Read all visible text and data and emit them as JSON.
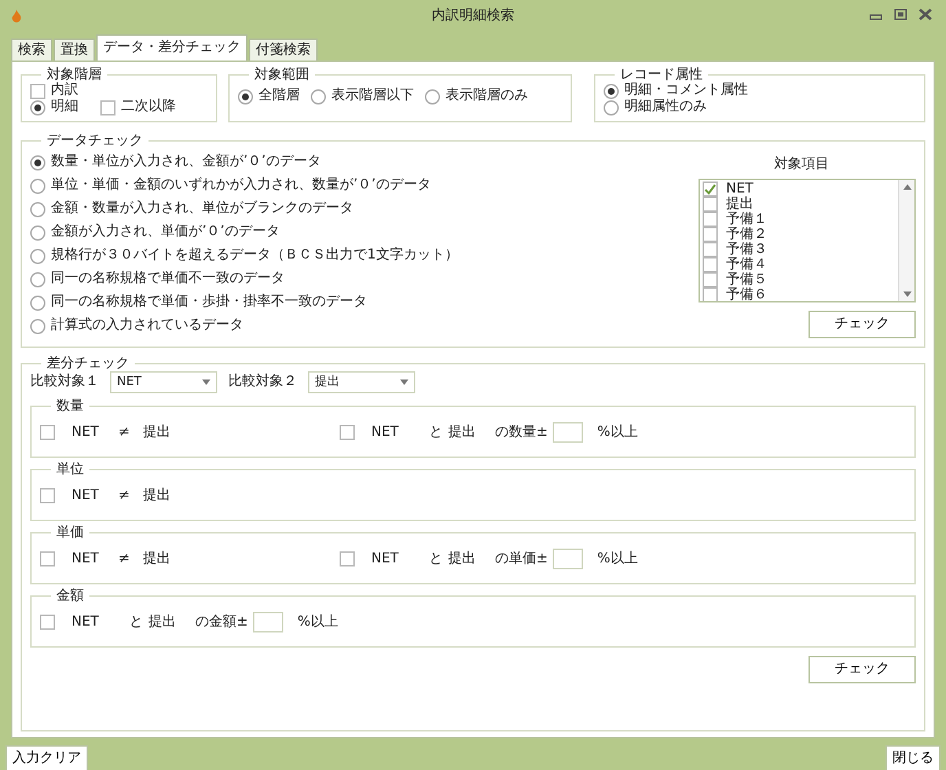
{
  "window": {
    "title": "内訳明細検索"
  },
  "tabs": [
    {
      "label": "検索",
      "selected": false
    },
    {
      "label": "置換",
      "selected": false
    },
    {
      "label": "データ・差分チェック",
      "selected": true
    },
    {
      "label": "付箋検索",
      "selected": false
    }
  ],
  "target_level": {
    "title": "対象階層",
    "items": [
      {
        "kind": "checkbox",
        "label": "内訳",
        "checked": false
      },
      {
        "kind": "radio",
        "label": "明細",
        "selected": true
      },
      {
        "kind": "checkbox",
        "label": "二次以降",
        "checked": false
      }
    ]
  },
  "target_scope": {
    "title": "対象範囲",
    "options": [
      {
        "label": "全階層",
        "selected": true
      },
      {
        "label": "表示階層以下",
        "selected": false
      },
      {
        "label": "表示階層のみ",
        "selected": false
      }
    ]
  },
  "record_attribute": {
    "title": "レコード属性",
    "options": [
      {
        "label": "明細・コメント属性",
        "selected": true
      },
      {
        "label": "明細属性のみ",
        "selected": false
      }
    ]
  },
  "data_check": {
    "title": "データチェック",
    "options": [
      {
        "label": "数量・単位が入力され、金額が’０’のデータ",
        "selected": true
      },
      {
        "label": "単位・単価・金額のいずれかが入力され、数量が’０’のデータ",
        "selected": false
      },
      {
        "label": "金額・数量が入力され、単位がブランクのデータ",
        "selected": false
      },
      {
        "label": "金額が入力され、単価が’０’のデータ",
        "selected": false
      },
      {
        "label": "規格行が３０バイトを超えるデータ（ＢＣＳ出力で1文字カット）",
        "selected": false
      },
      {
        "label": "同一の名称規格で単価不一致のデータ",
        "selected": false
      },
      {
        "label": "同一の名称規格で単価・歩掛・掛率不一致のデータ",
        "selected": false
      },
      {
        "label": "計算式の入力されているデータ",
        "selected": false
      }
    ],
    "target_items": {
      "title": "対象項目",
      "items": [
        {
          "label": "NET",
          "checked": true
        },
        {
          "label": "提出",
          "checked": false
        },
        {
          "label": "予備１",
          "checked": false
        },
        {
          "label": "予備２",
          "checked": false
        },
        {
          "label": "予備３",
          "checked": false
        },
        {
          "label": "予備４",
          "checked": false
        },
        {
          "label": "予備５",
          "checked": false
        },
        {
          "label": "予備６",
          "checked": false
        }
      ]
    },
    "button": "チェック"
  },
  "diff_check": {
    "title": "差分チェック",
    "compare_1": {
      "label": "比較対象１",
      "value": "NET"
    },
    "compare_2": {
      "label": "比較対象２",
      "value": "提出"
    },
    "groups": [
      {
        "title": "数量",
        "rows": [
          {
            "kind": "not_equal",
            "checked": false,
            "left": "NET",
            "operator": "≠",
            "right": "提出"
          },
          {
            "kind": "percent",
            "checked": false,
            "left": "NET",
            "operator": "と",
            "right": "提出",
            "suffix": "の数量±",
            "unit": "%以上"
          }
        ]
      },
      {
        "title": "単位",
        "rows": [
          {
            "kind": "not_equal",
            "checked": false,
            "left": "NET",
            "operator": "≠",
            "right": "提出"
          }
        ]
      },
      {
        "title": "単価",
        "rows": [
          {
            "kind": "not_equal",
            "checked": false,
            "left": "NET",
            "operator": "≠",
            "right": "提出"
          },
          {
            "kind": "percent",
            "checked": false,
            "left": "NET",
            "operator": "と",
            "right": "提出",
            "suffix": "の単価±",
            "unit": "%以上"
          }
        ]
      },
      {
        "title": "金額",
        "rows": [
          {
            "kind": "percent",
            "checked": false,
            "left": "NET",
            "operator": "と",
            "right": "提出",
            "suffix": "の金額±",
            "unit": "%以上"
          }
        ]
      }
    ],
    "button": "チェック"
  },
  "footer": {
    "clear_button": "入力クリア",
    "close_button": "閉じる"
  }
}
